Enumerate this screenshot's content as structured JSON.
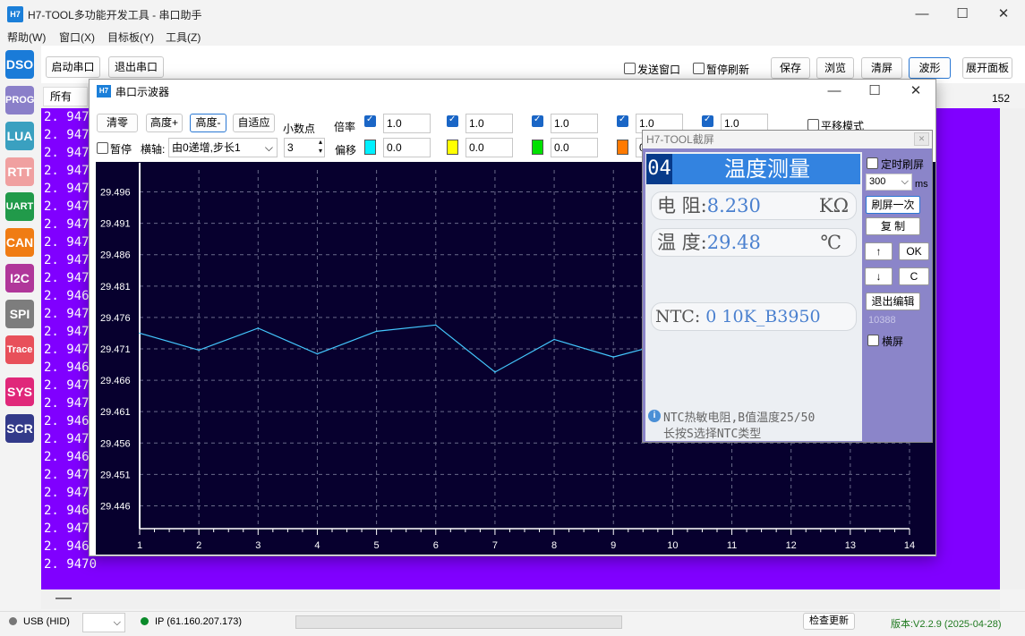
{
  "app": {
    "logo": "H7",
    "title": "H7-TOOL多功能开发工具 - 串口助手"
  },
  "window_controls": {
    "minimize": "—",
    "maximize": "☐",
    "close": "✕"
  },
  "menu": [
    "帮助(W)",
    "窗口(X)",
    "目标板(Y)",
    "工具(Z)"
  ],
  "toolbar": {
    "open_port": "启动串口",
    "close_port": "退出串口",
    "send_window": "发送窗口",
    "pause_refresh": "暂停刷新",
    "save": "保存",
    "browse": "浏览",
    "clear": "清屏",
    "wave": "波形",
    "expand_panel": "展开面板"
  },
  "sidebar": [
    {
      "label": "DSO",
      "color": "#1a7bd8"
    },
    {
      "label": "PROG",
      "color": "#8a7fc9"
    },
    {
      "label": "LUA",
      "color": "#3aa0c0"
    },
    {
      "label": "RTT",
      "color": "#f0a0a0"
    },
    {
      "label": "UART",
      "color": "#219a4a"
    },
    {
      "label": "CAN",
      "color": "#f07c13"
    },
    {
      "label": "I2C",
      "color": "#b0379a"
    },
    {
      "label": "SPI",
      "color": "#7d7d7d"
    },
    {
      "label": "Trace",
      "color": "#e8505a"
    },
    {
      "label": "SYS",
      "color": "#e0287a"
    },
    {
      "label": "SCR",
      "color": "#333a8a"
    }
  ],
  "terminal": {
    "tab": "所有",
    "count": "152",
    "lines": [
      "2. 9475",
      "2. 9470",
      "2. 9474",
      "2. 9471",
      "2. 9476",
      "2. 9471",
      "2. 9472",
      "2. 9477",
      "2. 9470",
      "2. 9474",
      "2. 9469",
      "2. 9473",
      "2. 9470",
      "2. 9474",
      "2. 9469",
      "2. 9473",
      "2. 9474",
      "2. 9466",
      "2. 9472",
      "2. 9469",
      "2. 9474",
      "2. 9472",
      "2. 9468",
      "2. 9476",
      "2. 9468",
      "2. 9470"
    ]
  },
  "status": {
    "usb": "USB (HID)",
    "ip": "IP (61.160.207.173)",
    "check_update": "检查更新",
    "version": "版本:V2.2.9 (2025-04-28)"
  },
  "scope": {
    "icon": "H7",
    "title": "串口示波器",
    "zero": "清零",
    "height_plus": "高度+",
    "height_minus": "高度-",
    "auto": "自适应",
    "decimals_label": "小数点",
    "decimals_value": "3",
    "pause": "暂停",
    "haxis_label": "横轴:",
    "haxis_value": "由0递增,步长1",
    "scale_label": "倍率",
    "offset_label": "偏移",
    "channels": [
      {
        "scale": "1.0",
        "offset": "0.0",
        "color": "#00f0ff"
      },
      {
        "scale": "1.0",
        "offset": "0.0",
        "color": "#ffff00"
      },
      {
        "scale": "1.0",
        "offset": "0.0",
        "color": "#00e000"
      },
      {
        "scale": "1.0",
        "offset": "0",
        "color": "#ff7a00"
      },
      {
        "scale": "1.0",
        "offset": "",
        "color": ""
      }
    ],
    "pan_mode": "平移模式"
  },
  "chart_data": {
    "type": "line",
    "x": [
      1,
      2,
      3,
      4,
      5,
      6,
      7,
      8,
      9,
      10
    ],
    "series": [
      {
        "values": [
          29.4735,
          29.4708,
          29.4743,
          29.4702,
          29.4738,
          29.4748,
          29.4673,
          29.4725,
          29.4697,
          29.4722
        ],
        "color": "#44c8ff"
      }
    ],
    "yticks": [
      "29.496",
      "29.491",
      "29.486",
      "29.481",
      "29.476",
      "29.471",
      "29.466",
      "29.461",
      "29.456",
      "29.451",
      "29.446"
    ],
    "xticks": [
      "1",
      "2",
      "3",
      "4",
      "5",
      "6",
      "7",
      "8",
      "9",
      "10",
      "11",
      "12",
      "13",
      "14"
    ],
    "ylim": [
      29.4425,
      29.4995
    ],
    "xlim": [
      1,
      14
    ],
    "grid": true
  },
  "screenshot": {
    "title": "H7-TOOL截屏",
    "lcd": {
      "num": "04",
      "title": "温度测量",
      "r_label": "电 阻:",
      "r_value": "8.230",
      "r_unit": "KΩ",
      "t_label": "温 度:",
      "t_value": "29.48",
      "t_unit": "℃",
      "ntc_label": "NTC:",
      "ntc_value": "0 10K_B3950",
      "info1": "NTC热敏电阻,B值温度25/50",
      "info2": "长按S选择NTC类型"
    },
    "timer_refresh": "定时刷屏",
    "interval": "300",
    "interval_unit": "ms",
    "refresh_once": "刷屏一次",
    "copy": "复 制",
    "up": "↑",
    "ok": "OK",
    "down": "↓",
    "c": "C",
    "exit_edit": "退出编辑",
    "code": "10388",
    "landscape": "横屏"
  }
}
